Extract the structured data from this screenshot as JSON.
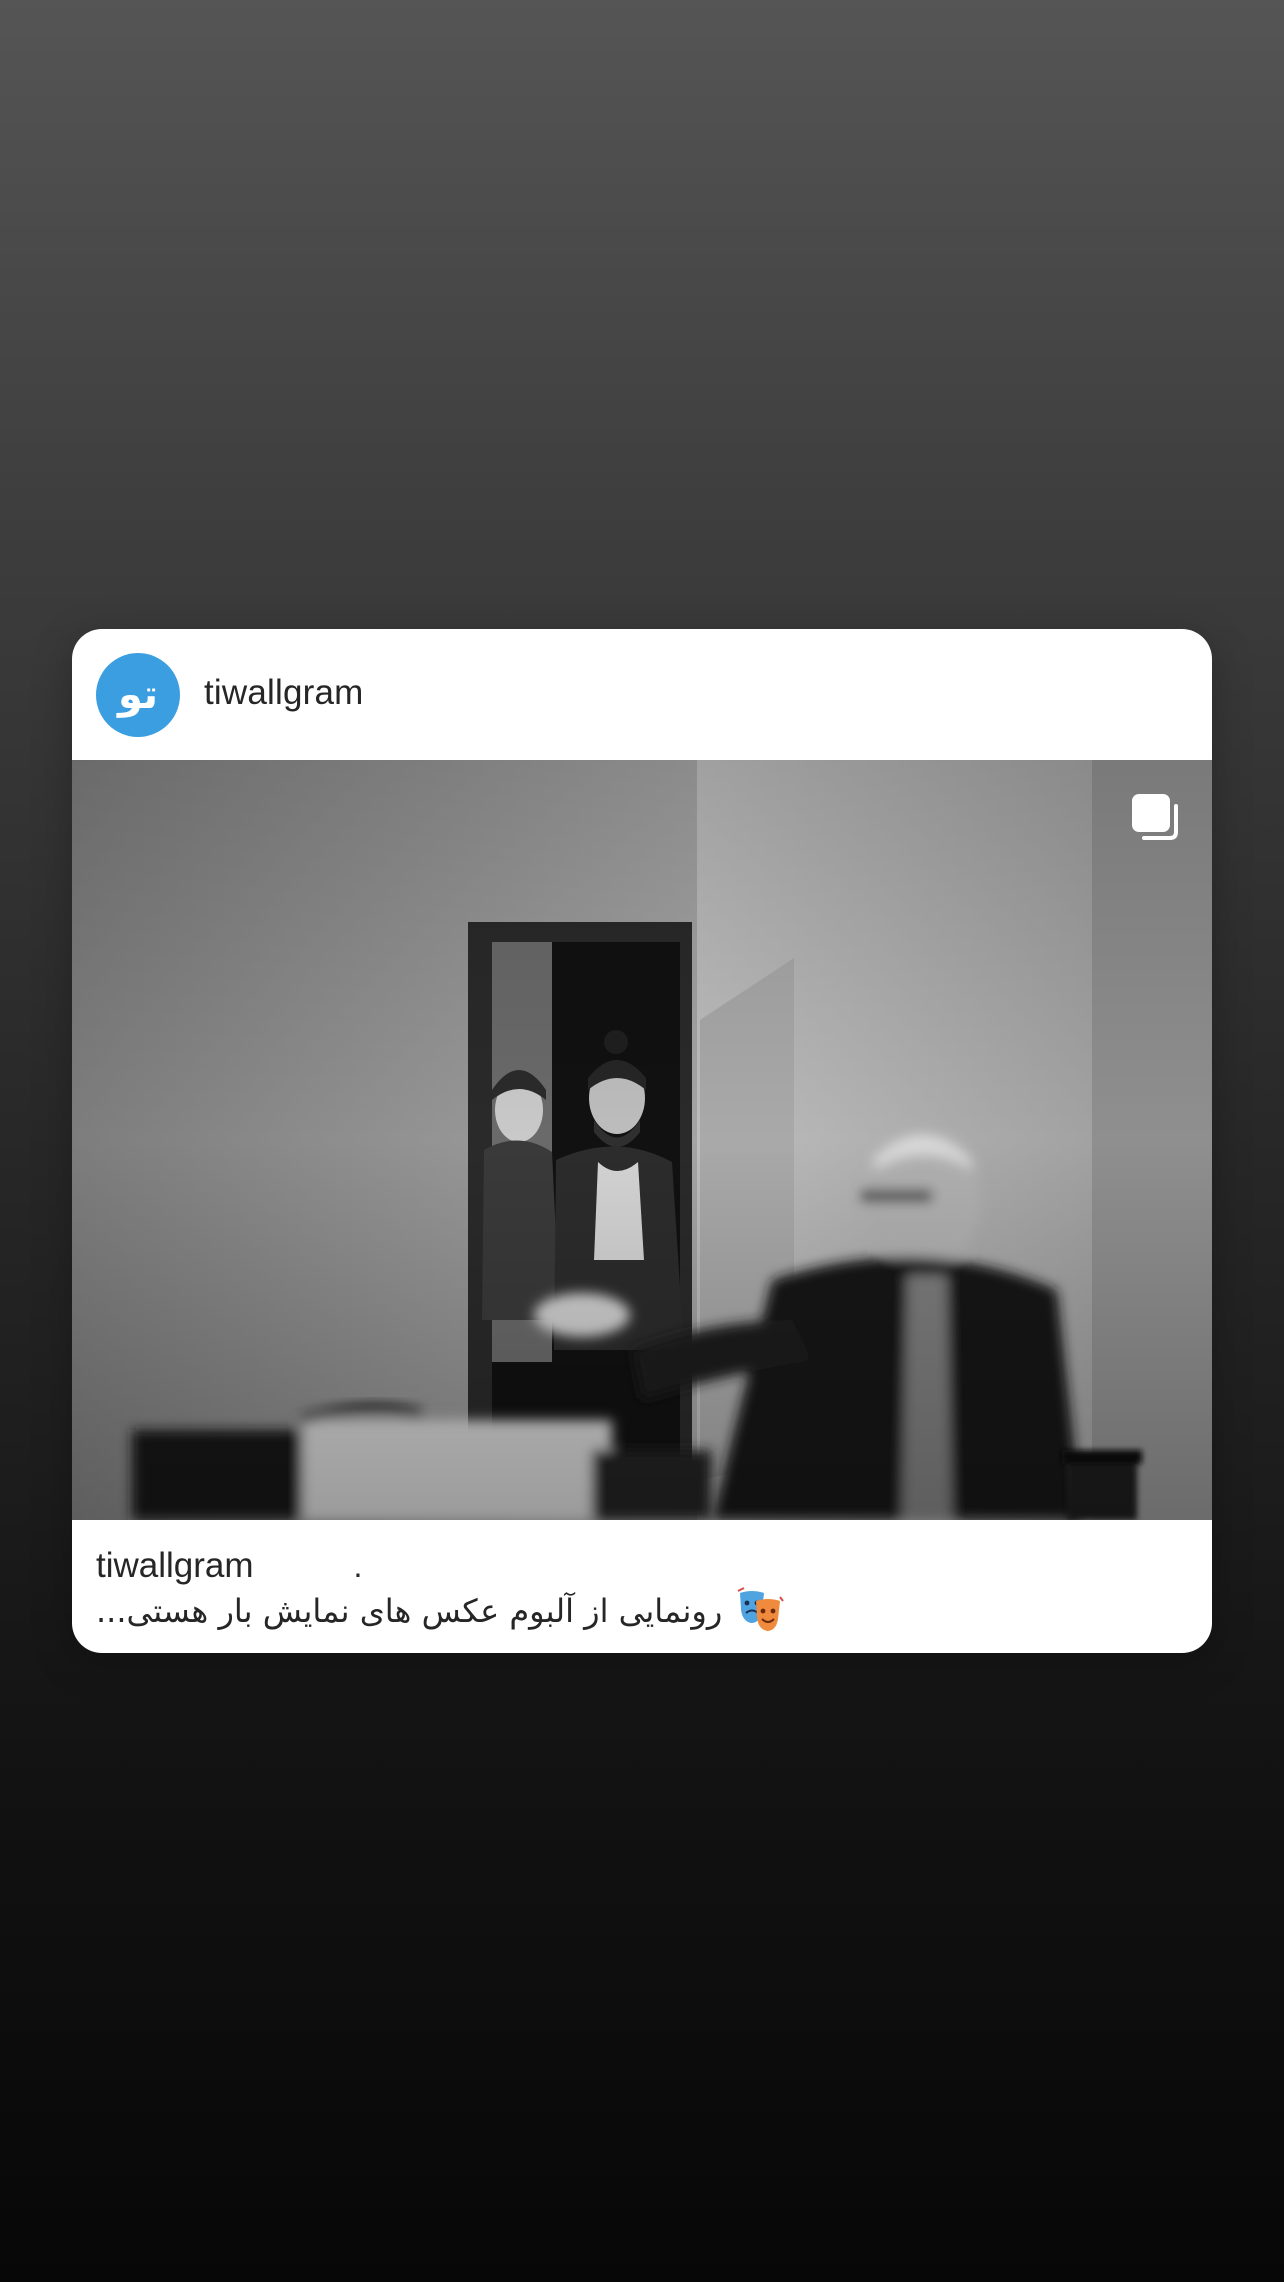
{
  "post": {
    "header": {
      "username": "tiwallgram",
      "avatar_text": "تو",
      "avatar_color": "#3b9ee0"
    },
    "media": {
      "icon": "carousel-multiple-icon",
      "style": "black-and-white photo"
    },
    "caption": {
      "username": "tiwallgram",
      "dot": ".",
      "text": "رونمایی از آلبوم عکس های نمایش بار هستی...",
      "emoji_icon": "performing-arts-masks-icon"
    }
  }
}
